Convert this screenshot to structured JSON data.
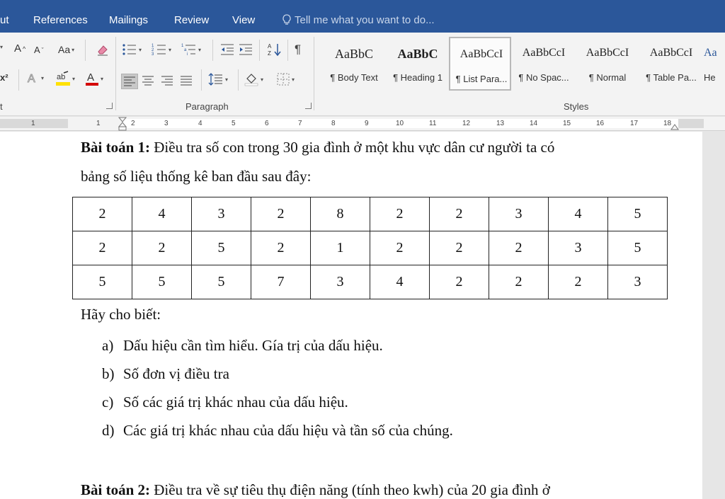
{
  "menu": {
    "tabs": [
      "ut",
      "References",
      "Mailings",
      "Review",
      "View"
    ],
    "tell_me": "Tell me what you want to do..."
  },
  "ribbon": {
    "font_buttons": {
      "grow": "A",
      "shrink": "A",
      "change_case": "Aa",
      "superscript": "x²"
    },
    "group_labels": {
      "font_fragment": "t",
      "paragraph": "Paragraph",
      "styles": "Styles"
    },
    "styles": [
      {
        "sample": "AaBbC",
        "name": "¶ Body Text"
      },
      {
        "sample": "AaBbC",
        "name": "¶ Heading 1"
      },
      {
        "sample": "AaBbCcI",
        "name": "¶ List Para..."
      },
      {
        "sample": "AaBbCcI",
        "name": "¶ No Spac..."
      },
      {
        "sample": "AaBbCcI",
        "name": "¶ Normal"
      },
      {
        "sample": "AaBbCcI",
        "name": "¶ Table Pa..."
      },
      {
        "sample": "Aa",
        "name": "He"
      }
    ],
    "colors": {
      "accent": "#2b579a",
      "highlight": "#ffe100",
      "font_color": "#d40000"
    }
  },
  "ruler": {
    "numbers": [
      "1",
      "1",
      "2",
      "3",
      "4",
      "5",
      "6",
      "7",
      "8",
      "9",
      "10",
      "11",
      "12",
      "13",
      "14",
      "15",
      "16",
      "17",
      "18"
    ]
  },
  "document": {
    "problem1_title": "Bài toán 1:",
    "problem1_text_line1": " Điều tra số con trong 30 gia đình ở một khu vực dân cư người ta có",
    "problem1_text_line2": "bảng số liệu thống kê ban đầu sau đây:",
    "table": [
      [
        "2",
        "4",
        "3",
        "2",
        "8",
        "2",
        "2",
        "3",
        "4",
        "5"
      ],
      [
        "2",
        "2",
        "5",
        "2",
        "1",
        "2",
        "2",
        "2",
        "3",
        "5"
      ],
      [
        "5",
        "5",
        "5",
        "7",
        "3",
        "4",
        "2",
        "2",
        "2",
        "3"
      ]
    ],
    "ask": "Hãy cho biết:",
    "items": [
      {
        "label": "a)",
        "text": "Dấu hiệu cần tìm hiểu. Gía trị của dấu hiệu."
      },
      {
        "label": "b)",
        "text": "Số đơn vị điều tra"
      },
      {
        "label": "c)",
        "text": "Số các giá trị khác nhau của dấu hiệu."
      },
      {
        "label": "d)",
        "text": "Các giá trị khác nhau của dấu hiệu và tần số của chúng."
      }
    ],
    "problem2_title": "Bài toán 2:",
    "problem2_text": " Điều tra về sự tiêu thụ điện năng (tính theo kwh) của 20 gia đình ở"
  }
}
